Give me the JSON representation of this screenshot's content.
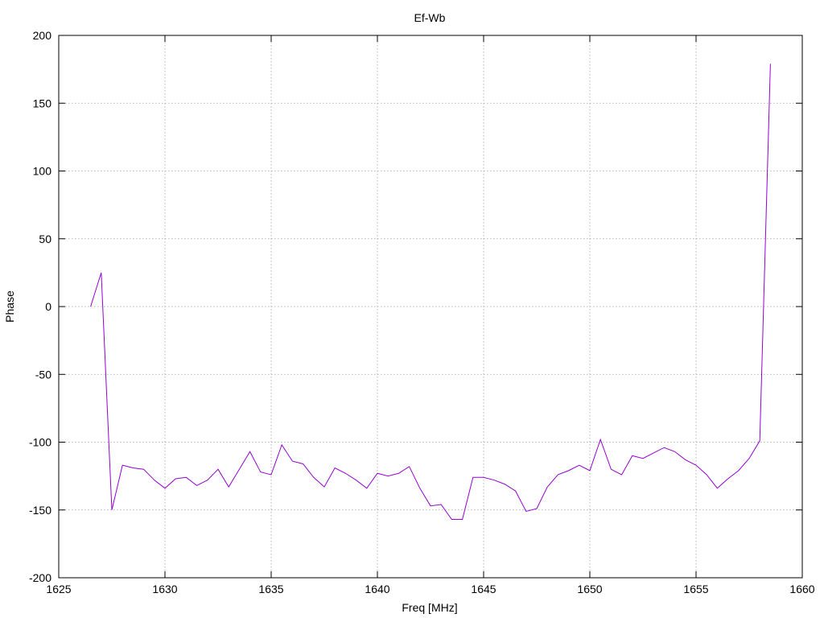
{
  "chart_data": {
    "type": "line",
    "title": "Ef-Wb",
    "xlabel": "Freq [MHz]",
    "ylabel": "Phase",
    "xlim": [
      1625,
      1660
    ],
    "ylim": [
      -200,
      200
    ],
    "xticks": [
      1625,
      1630,
      1635,
      1640,
      1645,
      1650,
      1655,
      1660
    ],
    "yticks": [
      -200,
      -150,
      -100,
      -50,
      0,
      50,
      100,
      150,
      200
    ],
    "xtick_labels": [
      "1625",
      "1630",
      "1635",
      "1640",
      "1645",
      "1650",
      "1655",
      "1660"
    ],
    "ytick_labels": [
      "-200",
      "-150",
      "-100",
      "-50",
      "0",
      "50",
      "100",
      "150",
      "200"
    ],
    "grid": true,
    "legend": false,
    "series": [
      {
        "color": "#9400d3",
        "x": [
          1626.5,
          1627.0,
          1627.5,
          1628.0,
          1628.5,
          1629.0,
          1629.5,
          1630.0,
          1630.5,
          1631.0,
          1631.5,
          1632.0,
          1632.5,
          1633.0,
          1633.5,
          1634.0,
          1634.5,
          1635.0,
          1635.5,
          1636.0,
          1636.5,
          1637.0,
          1637.5,
          1638.0,
          1638.5,
          1639.0,
          1639.5,
          1640.0,
          1640.5,
          1641.0,
          1641.5,
          1642.0,
          1642.5,
          1643.0,
          1643.5,
          1644.0,
          1644.5,
          1645.0,
          1645.5,
          1646.0,
          1646.5,
          1647.0,
          1647.5,
          1648.0,
          1648.5,
          1649.0,
          1649.5,
          1650.0,
          1650.5,
          1651.0,
          1651.5,
          1652.0,
          1652.5,
          1653.0,
          1653.5,
          1654.0,
          1654.5,
          1655.0,
          1655.5,
          1656.0,
          1656.5,
          1657.0,
          1657.5,
          1658.0,
          1658.5
        ],
        "y": [
          0,
          25,
          -150,
          -117,
          -119,
          -120,
          -128,
          -134,
          -127,
          -126,
          -132,
          -128,
          -120,
          -133,
          -120,
          -107,
          -122,
          -124,
          -102,
          -114,
          -116,
          -126,
          -133,
          -119,
          -123,
          -128,
          -134,
          -123,
          -125,
          -123,
          -118,
          -134,
          -147,
          -146,
          -157,
          -157,
          -126,
          -126,
          -128,
          -131,
          -136,
          -151,
          -149,
          -133,
          -124,
          -121,
          -117,
          -121,
          -98,
          -120,
          -124,
          -110,
          -112,
          -108,
          -104,
          -107,
          -113,
          -117,
          -124,
          -134,
          -127,
          -121,
          -112,
          -99,
          179
        ]
      }
    ]
  }
}
